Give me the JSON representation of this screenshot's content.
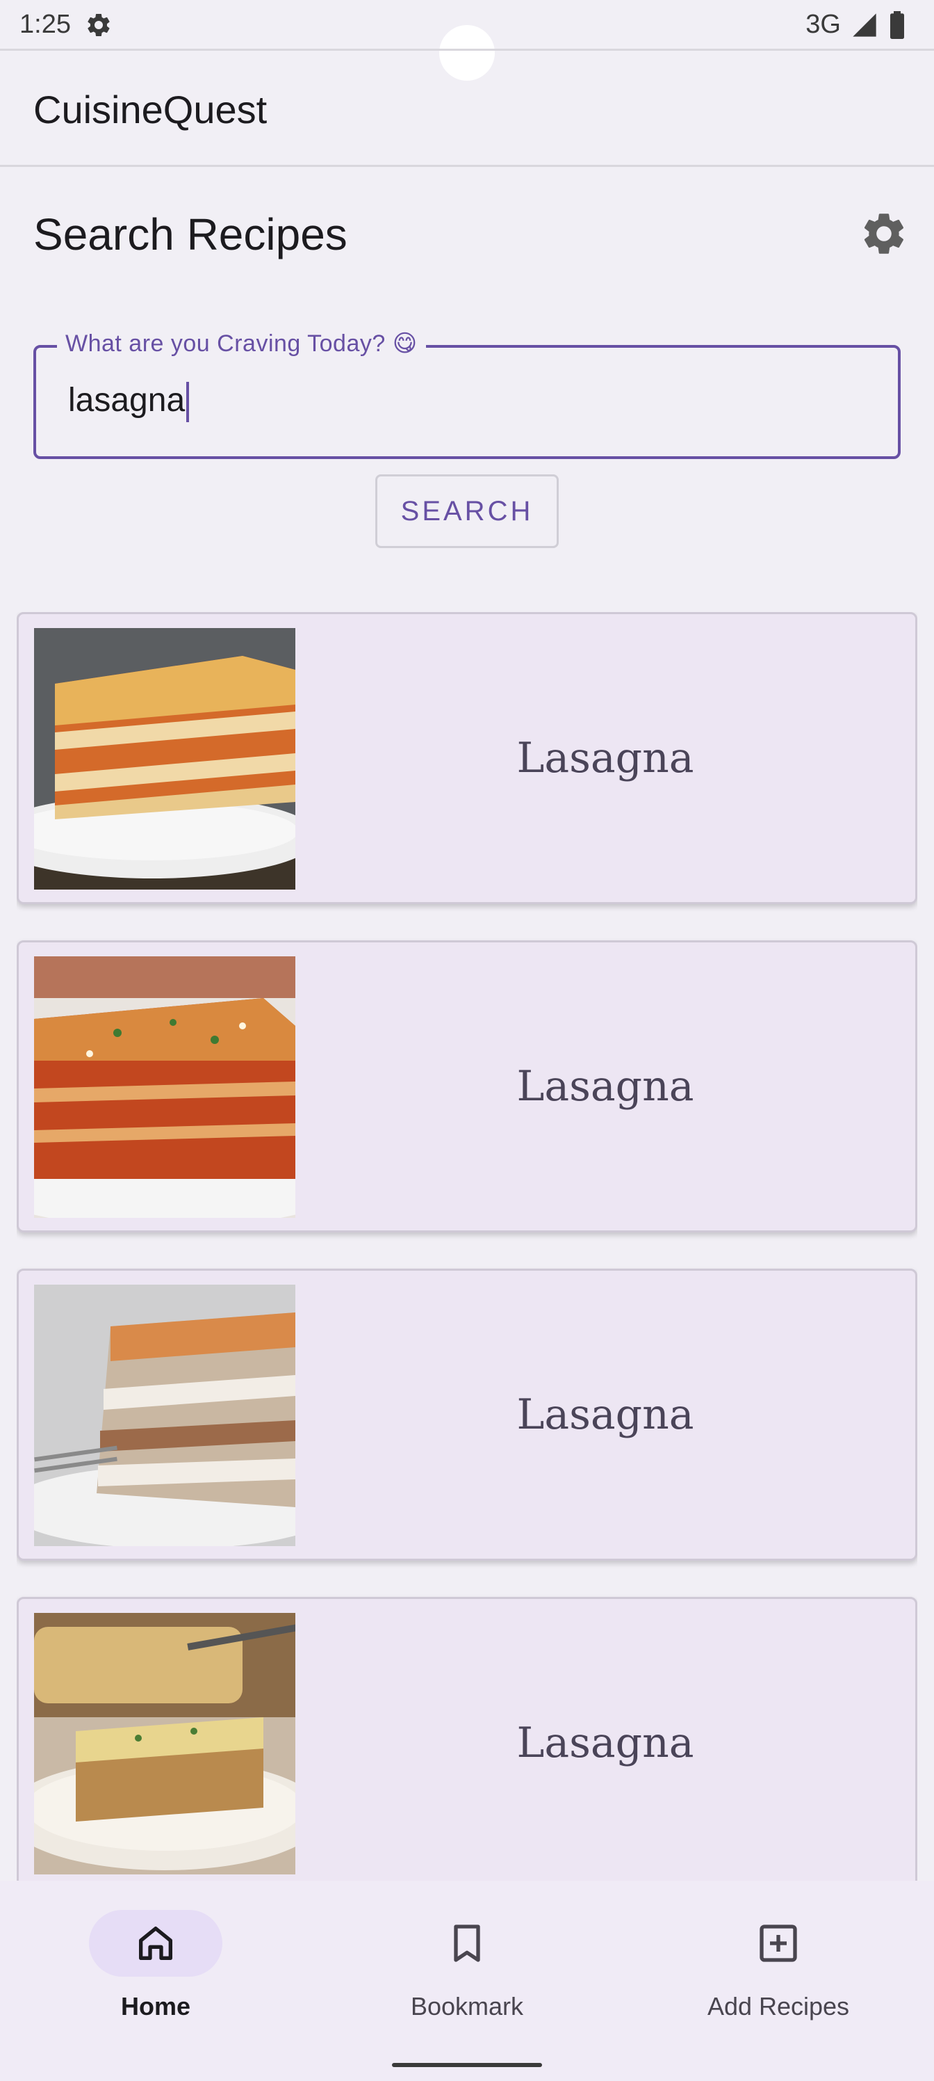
{
  "status_bar": {
    "time": "1:25",
    "network": "3G"
  },
  "app_bar": {
    "title": "CuisineQuest"
  },
  "page": {
    "title": "Search Recipes"
  },
  "search": {
    "label": "What are you Craving Today? 😋",
    "value": "lasagna",
    "button_label": "SEARCH"
  },
  "results": [
    {
      "title": "Lasagna"
    },
    {
      "title": "Lasagna"
    },
    {
      "title": "Lasagna"
    },
    {
      "title": "Lasagna"
    }
  ],
  "bottom_nav": {
    "items": [
      {
        "label": "Home",
        "icon": "home-icon",
        "active": true
      },
      {
        "label": "Bookmark",
        "icon": "bookmark-icon",
        "active": false
      },
      {
        "label": "Add Recipes",
        "icon": "add-box-icon",
        "active": false
      }
    ]
  },
  "colors": {
    "accent": "#6750a4",
    "card_background": "#ede6f3",
    "page_background": "#f1eff5"
  }
}
